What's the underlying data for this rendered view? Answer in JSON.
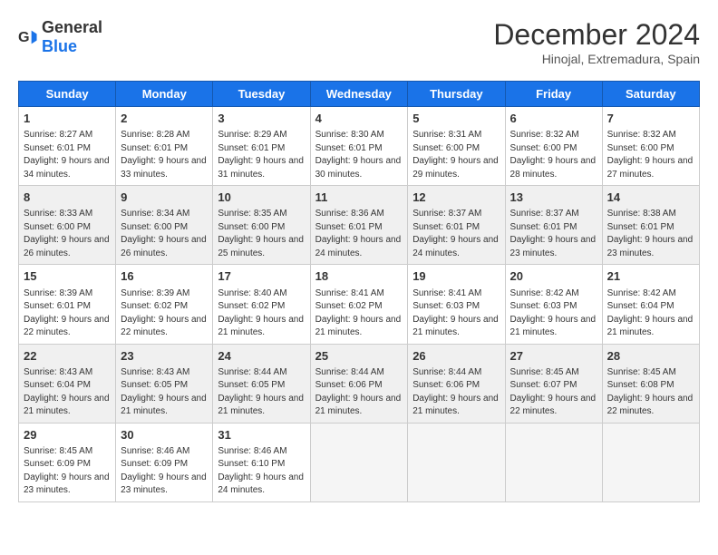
{
  "logo": {
    "general": "General",
    "blue": "Blue"
  },
  "title": "December 2024",
  "subtitle": "Hinojal, Extremadura, Spain",
  "headers": [
    "Sunday",
    "Monday",
    "Tuesday",
    "Wednesday",
    "Thursday",
    "Friday",
    "Saturday"
  ],
  "weeks": [
    [
      {
        "day": "1",
        "sunrise": "8:27 AM",
        "sunset": "6:01 PM",
        "daylight": "9 hours and 34 minutes."
      },
      {
        "day": "2",
        "sunrise": "8:28 AM",
        "sunset": "6:01 PM",
        "daylight": "9 hours and 33 minutes."
      },
      {
        "day": "3",
        "sunrise": "8:29 AM",
        "sunset": "6:01 PM",
        "daylight": "9 hours and 31 minutes."
      },
      {
        "day": "4",
        "sunrise": "8:30 AM",
        "sunset": "6:01 PM",
        "daylight": "9 hours and 30 minutes."
      },
      {
        "day": "5",
        "sunrise": "8:31 AM",
        "sunset": "6:00 PM",
        "daylight": "9 hours and 29 minutes."
      },
      {
        "day": "6",
        "sunrise": "8:32 AM",
        "sunset": "6:00 PM",
        "daylight": "9 hours and 28 minutes."
      },
      {
        "day": "7",
        "sunrise": "8:32 AM",
        "sunset": "6:00 PM",
        "daylight": "9 hours and 27 minutes."
      }
    ],
    [
      {
        "day": "8",
        "sunrise": "8:33 AM",
        "sunset": "6:00 PM",
        "daylight": "9 hours and 26 minutes."
      },
      {
        "day": "9",
        "sunrise": "8:34 AM",
        "sunset": "6:00 PM",
        "daylight": "9 hours and 26 minutes."
      },
      {
        "day": "10",
        "sunrise": "8:35 AM",
        "sunset": "6:00 PM",
        "daylight": "9 hours and 25 minutes."
      },
      {
        "day": "11",
        "sunrise": "8:36 AM",
        "sunset": "6:01 PM",
        "daylight": "9 hours and 24 minutes."
      },
      {
        "day": "12",
        "sunrise": "8:37 AM",
        "sunset": "6:01 PM",
        "daylight": "9 hours and 24 minutes."
      },
      {
        "day": "13",
        "sunrise": "8:37 AM",
        "sunset": "6:01 PM",
        "daylight": "9 hours and 23 minutes."
      },
      {
        "day": "14",
        "sunrise": "8:38 AM",
        "sunset": "6:01 PM",
        "daylight": "9 hours and 23 minutes."
      }
    ],
    [
      {
        "day": "15",
        "sunrise": "8:39 AM",
        "sunset": "6:01 PM",
        "daylight": "9 hours and 22 minutes."
      },
      {
        "day": "16",
        "sunrise": "8:39 AM",
        "sunset": "6:02 PM",
        "daylight": "9 hours and 22 minutes."
      },
      {
        "day": "17",
        "sunrise": "8:40 AM",
        "sunset": "6:02 PM",
        "daylight": "9 hours and 21 minutes."
      },
      {
        "day": "18",
        "sunrise": "8:41 AM",
        "sunset": "6:02 PM",
        "daylight": "9 hours and 21 minutes."
      },
      {
        "day": "19",
        "sunrise": "8:41 AM",
        "sunset": "6:03 PM",
        "daylight": "9 hours and 21 minutes."
      },
      {
        "day": "20",
        "sunrise": "8:42 AM",
        "sunset": "6:03 PM",
        "daylight": "9 hours and 21 minutes."
      },
      {
        "day": "21",
        "sunrise": "8:42 AM",
        "sunset": "6:04 PM",
        "daylight": "9 hours and 21 minutes."
      }
    ],
    [
      {
        "day": "22",
        "sunrise": "8:43 AM",
        "sunset": "6:04 PM",
        "daylight": "9 hours and 21 minutes."
      },
      {
        "day": "23",
        "sunrise": "8:43 AM",
        "sunset": "6:05 PM",
        "daylight": "9 hours and 21 minutes."
      },
      {
        "day": "24",
        "sunrise": "8:44 AM",
        "sunset": "6:05 PM",
        "daylight": "9 hours and 21 minutes."
      },
      {
        "day": "25",
        "sunrise": "8:44 AM",
        "sunset": "6:06 PM",
        "daylight": "9 hours and 21 minutes."
      },
      {
        "day": "26",
        "sunrise": "8:44 AM",
        "sunset": "6:06 PM",
        "daylight": "9 hours and 21 minutes."
      },
      {
        "day": "27",
        "sunrise": "8:45 AM",
        "sunset": "6:07 PM",
        "daylight": "9 hours and 22 minutes."
      },
      {
        "day": "28",
        "sunrise": "8:45 AM",
        "sunset": "6:08 PM",
        "daylight": "9 hours and 22 minutes."
      }
    ],
    [
      {
        "day": "29",
        "sunrise": "8:45 AM",
        "sunset": "6:09 PM",
        "daylight": "9 hours and 23 minutes."
      },
      {
        "day": "30",
        "sunrise": "8:46 AM",
        "sunset": "6:09 PM",
        "daylight": "9 hours and 23 minutes."
      },
      {
        "day": "31",
        "sunrise": "8:46 AM",
        "sunset": "6:10 PM",
        "daylight": "9 hours and 24 minutes."
      },
      null,
      null,
      null,
      null
    ]
  ]
}
